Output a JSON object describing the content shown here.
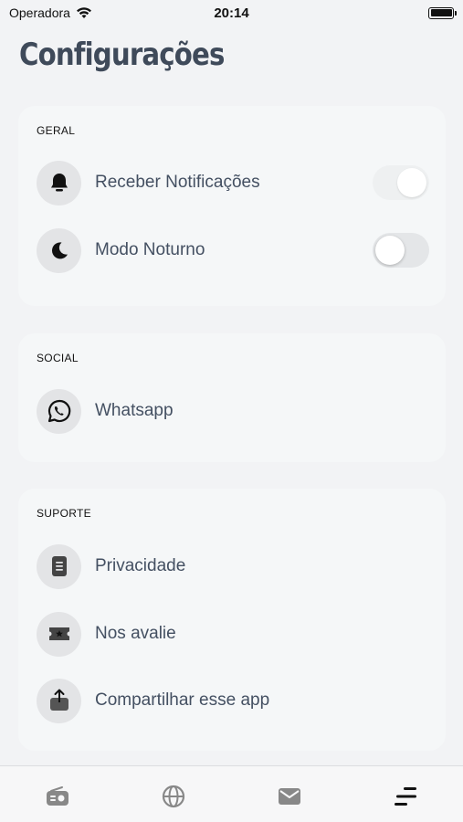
{
  "status_bar": {
    "carrier": "Operadora",
    "time": "20:14"
  },
  "page": {
    "title": "Configurações"
  },
  "sections": {
    "general": {
      "label": "GERAL",
      "items": [
        {
          "label": "Receber Notificações",
          "icon": "bell-icon",
          "toggle": true
        },
        {
          "label": "Modo Noturno",
          "icon": "moon-icon",
          "toggle": false
        }
      ]
    },
    "social": {
      "label": "SOCIAL",
      "items": [
        {
          "label": "Whatsapp",
          "icon": "whatsapp-icon"
        }
      ]
    },
    "support": {
      "label": "SUPORTE",
      "items": [
        {
          "label": "Privacidade",
          "icon": "document-icon"
        },
        {
          "label": "Nos avalie",
          "icon": "ticket-star-icon"
        },
        {
          "label": "Compartilhar esse app",
          "icon": "share-icon"
        }
      ]
    }
  },
  "tab_bar": {
    "tabs": [
      {
        "icon": "radio-icon",
        "active": false
      },
      {
        "icon": "globe-icon",
        "active": false
      },
      {
        "icon": "mail-icon",
        "active": false
      },
      {
        "icon": "menu-icon",
        "active": true
      }
    ]
  },
  "colors": {
    "background": "#f2f3f5",
    "card": "#f5f7f8",
    "text": "#3f4a5a",
    "icon_bg": "#e3e4e6"
  }
}
